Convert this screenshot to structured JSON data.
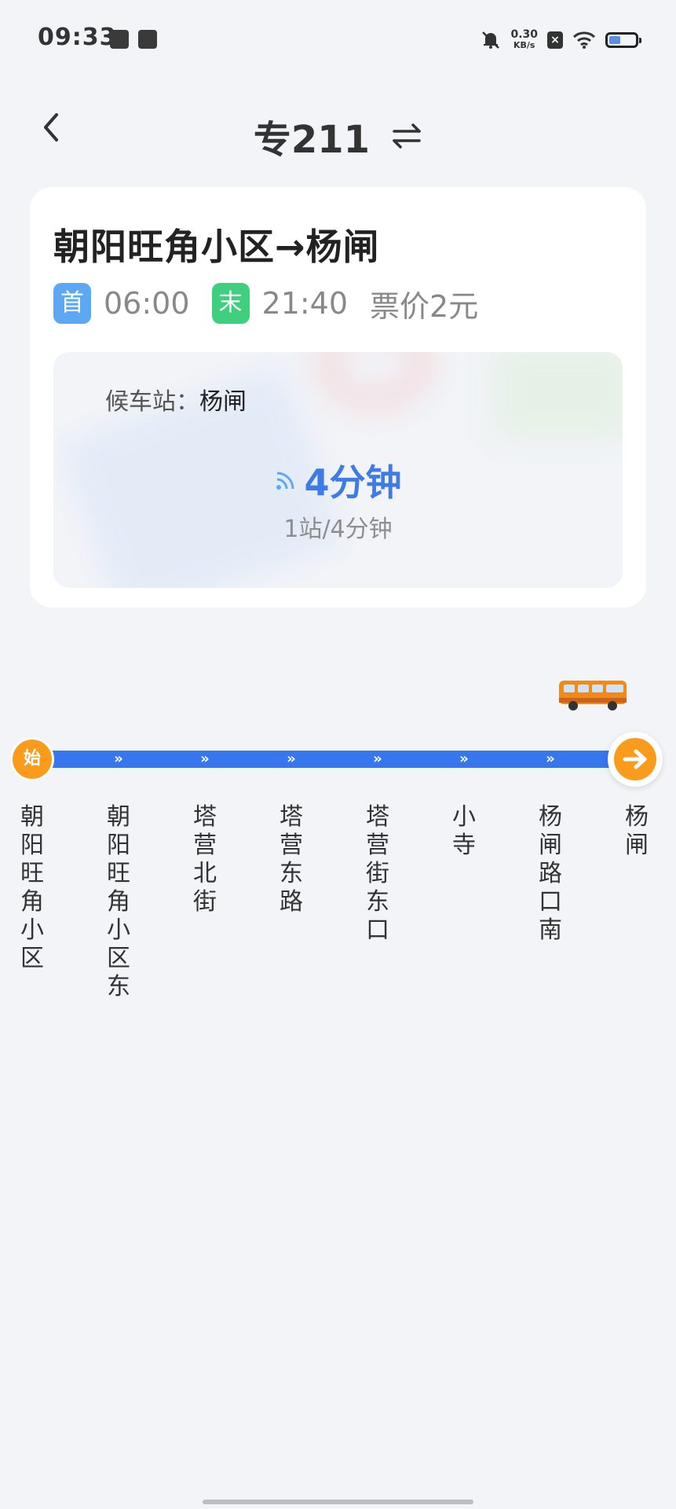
{
  "status_bar": {
    "time": "09:33",
    "speed_value": "0.30",
    "speed_unit": "KB/s",
    "battery_level": 0.45
  },
  "header": {
    "title": "专211",
    "back_icon": "chevron-left-icon",
    "swap_icon": "swap-direction-icon"
  },
  "card": {
    "route": "朝阳旺角小区→杨闸",
    "first_badge": "首",
    "first_time": "06:00",
    "last_badge": "末",
    "last_time": "21:40",
    "fare": "票价2元",
    "wait_label": "候车站：",
    "wait_station": "杨闸",
    "eta": "4分钟",
    "eta_detail": "1站/4分钟"
  },
  "line": {
    "start_badge": "始",
    "arrow_glyph": "»",
    "stops": [
      "朝阳旺角小区",
      "朝阳旺角小区东",
      "塔营北街",
      "塔营东路",
      "塔营街东口",
      "小寺",
      "杨闸路口南",
      "杨闸"
    ]
  },
  "colors": {
    "accent": "#3e7be6",
    "line": "#3876ee",
    "orange": "#fa9b1c",
    "first": "#5da8f2",
    "last": "#3fcf7e"
  }
}
